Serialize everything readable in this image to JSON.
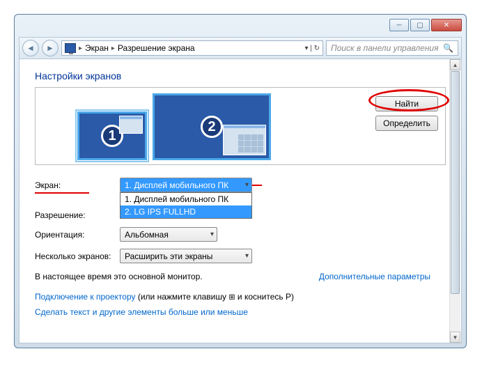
{
  "breadcrumb": {
    "item1": "Экран",
    "item2": "Разрешение экрана"
  },
  "search": {
    "placeholder": "Поиск в панели управления"
  },
  "page": {
    "title": "Настройки экранов"
  },
  "monitors": {
    "m1": "1",
    "m2": "2"
  },
  "buttons": {
    "find": "Найти",
    "identify": "Определить"
  },
  "labels": {
    "screen": "Экран:",
    "resolution": "Разрешение:",
    "orientation": "Ориентация:",
    "multiple": "Несколько экранов:"
  },
  "values": {
    "screen_selected": "1. Дисплей мобильного ПК",
    "orientation": "Альбомная",
    "multiple": "Расширить эти экраны"
  },
  "screen_options": {
    "opt1": "1. Дисплей мобильного ПК",
    "opt2": "2. LG IPS FULLHD"
  },
  "text": {
    "main_monitor": "В настоящее время это основной монитор.",
    "advanced": "Дополнительные параметры",
    "projector_link": "Подключение к проектору",
    "projector_hint1": " (или нажмите клавишу ",
    "projector_hint2": " и коснитесь P)",
    "text_size": "Сделать текст и другие элементы больше или меньше"
  }
}
